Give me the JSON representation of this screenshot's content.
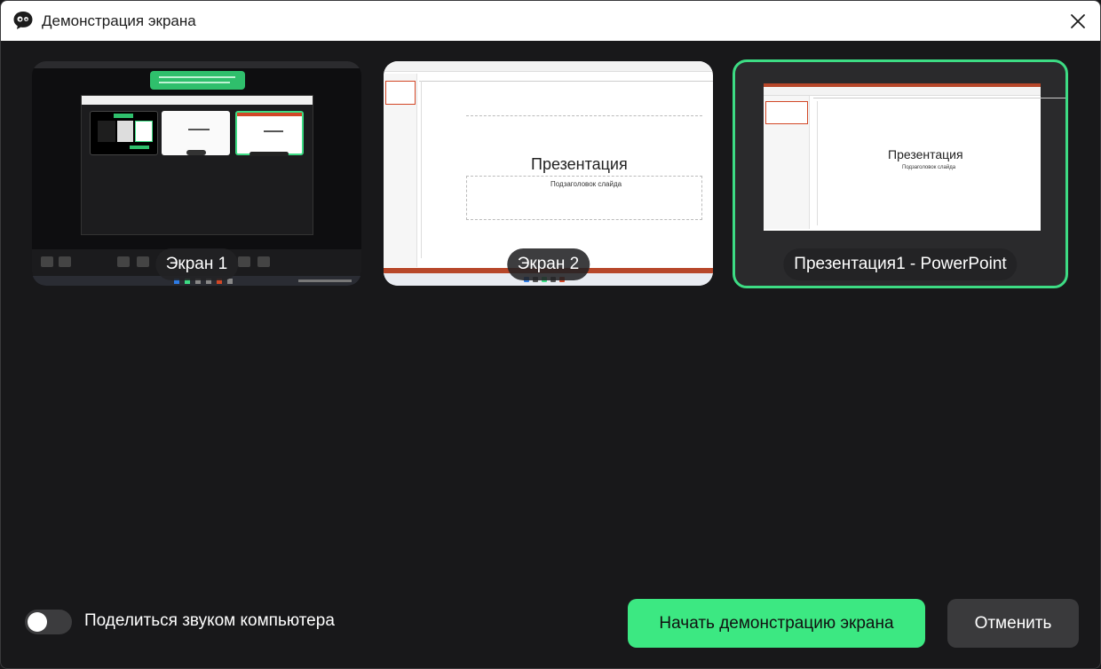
{
  "window": {
    "title": "Демонстрация экрана",
    "app_icon": "chat-bubble-eyes-icon",
    "close_icon": "close-icon"
  },
  "sources": [
    {
      "label": "Экран 1",
      "selected": false
    },
    {
      "label": "Экран 2",
      "selected": false
    },
    {
      "label": "Презентация1 - PowerPoint",
      "selected": true
    }
  ],
  "slide_preview": {
    "title": "Презентация",
    "subtitle": "Подзаголовок слайда"
  },
  "share_audio": {
    "label": "Поделиться звуком компьютера",
    "enabled": false
  },
  "actions": {
    "start_label": "Начать демонстрацию экрана",
    "cancel_label": "Отменить"
  },
  "colors": {
    "accent": "#3ce882",
    "background": "#18181a",
    "secondary_button": "#3a3a3c",
    "selection_border": "#3ddc84",
    "powerpoint": "#b7472a"
  }
}
